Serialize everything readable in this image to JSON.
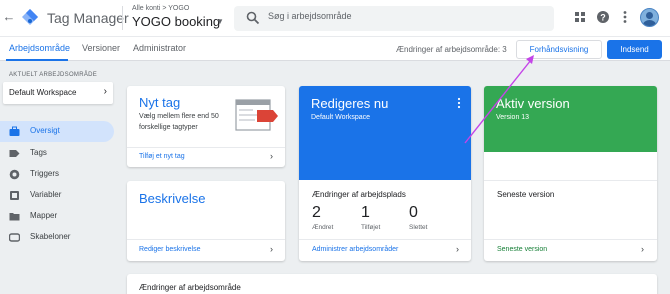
{
  "header": {
    "app_title": "Tag Manager",
    "breadcrumb": "Alle konti > YOGO",
    "container_name": "YOGO booking",
    "search_placeholder": "Søg i arbejdsområde"
  },
  "nav": {
    "tabs": [
      {
        "label": "Arbejdsområde",
        "active": true
      },
      {
        "label": "Versioner",
        "active": false
      },
      {
        "label": "Administrator",
        "active": false
      }
    ],
    "changes_label": "Ændringer af arbejdsområde: 3",
    "preview_label": "Forhåndsvisning",
    "submit_label": "Indsend"
  },
  "sidebar": {
    "workspace_heading": "AKTUELT ARBEJDSOMRÅDE",
    "workspace_name": "Default Workspace",
    "items": [
      {
        "label": "Oversigt",
        "icon": "briefcase-icon",
        "active": true
      },
      {
        "label": "Tags",
        "icon": "tag-icon",
        "active": false
      },
      {
        "label": "Triggers",
        "icon": "trigger-icon",
        "active": false
      },
      {
        "label": "Variabler",
        "icon": "variable-icon",
        "active": false
      },
      {
        "label": "Mapper",
        "icon": "folder-icon",
        "active": false
      },
      {
        "label": "Skabeloner",
        "icon": "template-icon",
        "active": false
      }
    ]
  },
  "cards": {
    "new_tag": {
      "title": "Nyt tag",
      "description": "Vælg mellem flere end 50 forskellige tagtyper",
      "link": "Tilføj et nyt tag"
    },
    "description": {
      "title": "Beskrivelse",
      "link": "Rediger beskrivelse"
    },
    "editing": {
      "title": "Redigeres nu",
      "subtitle": "Default Workspace",
      "changes_heading": "Ændringer af arbejdsplads",
      "stats": [
        {
          "value": "2",
          "label": "Ændret"
        },
        {
          "value": "1",
          "label": "Tilføjet"
        },
        {
          "value": "0",
          "label": "Slettet"
        }
      ],
      "link": "Administrer arbejdsområder"
    },
    "live": {
      "title": "Aktiv version",
      "subtitle": "Version 13",
      "latest_heading": "Seneste version",
      "link": "Seneste version"
    },
    "bottom": {
      "title": "Ændringer af arbejdsområde"
    }
  },
  "colors": {
    "accent": "#1a73e8",
    "live": "#34a853",
    "annotation_arrow": "#c444e8"
  }
}
